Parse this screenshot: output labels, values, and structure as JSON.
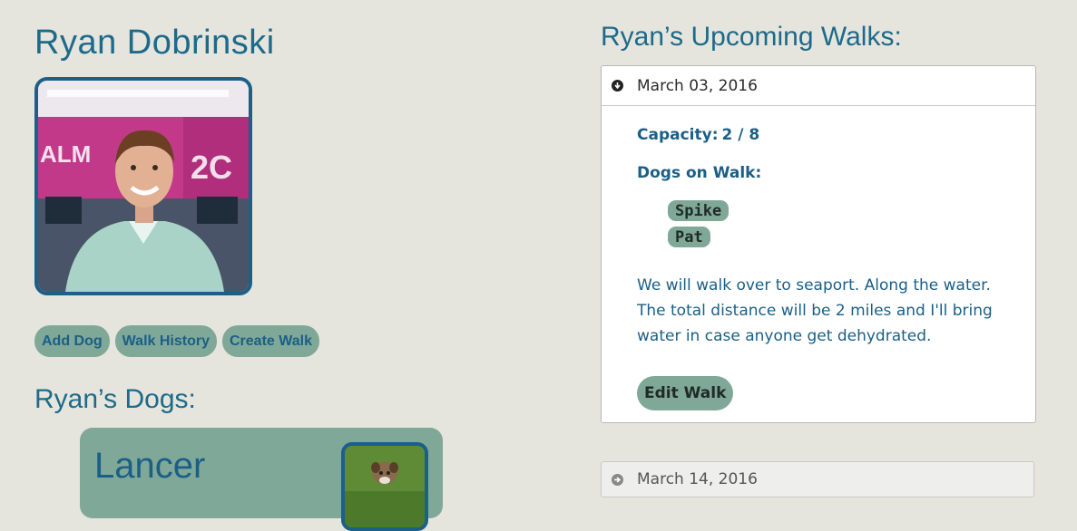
{
  "profile": {
    "name": "Ryan Dobrinski"
  },
  "actions": {
    "add_dog": "Add Dog",
    "walk_history": "Walk History",
    "create_walk": "Create Walk"
  },
  "dogs_section": {
    "heading": "Ryan’s Dogs:",
    "dogs": [
      {
        "name": "Lancer"
      }
    ]
  },
  "walks_section": {
    "heading": "Ryan’s Upcoming Walks:",
    "walks": [
      {
        "date": "March 03, 2016",
        "expanded": true,
        "capacity_label": "Capacity:",
        "capacity_value": "2 / 8",
        "dogs_label": "Dogs on Walk:",
        "dogs": [
          "Spike",
          "Pat"
        ],
        "description": "We will walk over to seaport. Along the water. The total distance will be 2 miles and I'll bring water in case anyone get dehydrated.",
        "edit_label": "Edit Walk"
      },
      {
        "date": "March 14, 2016",
        "expanded": false
      }
    ]
  },
  "colors": {
    "background": "#e6e5dd",
    "heading_blue": "#1d6a8a",
    "pill_green": "#80a898",
    "frame_blue": "#1a6089"
  },
  "icons": {
    "expand_open": "circle-arrow-down-icon",
    "expand_closed": "circle-arrow-right-icon"
  }
}
